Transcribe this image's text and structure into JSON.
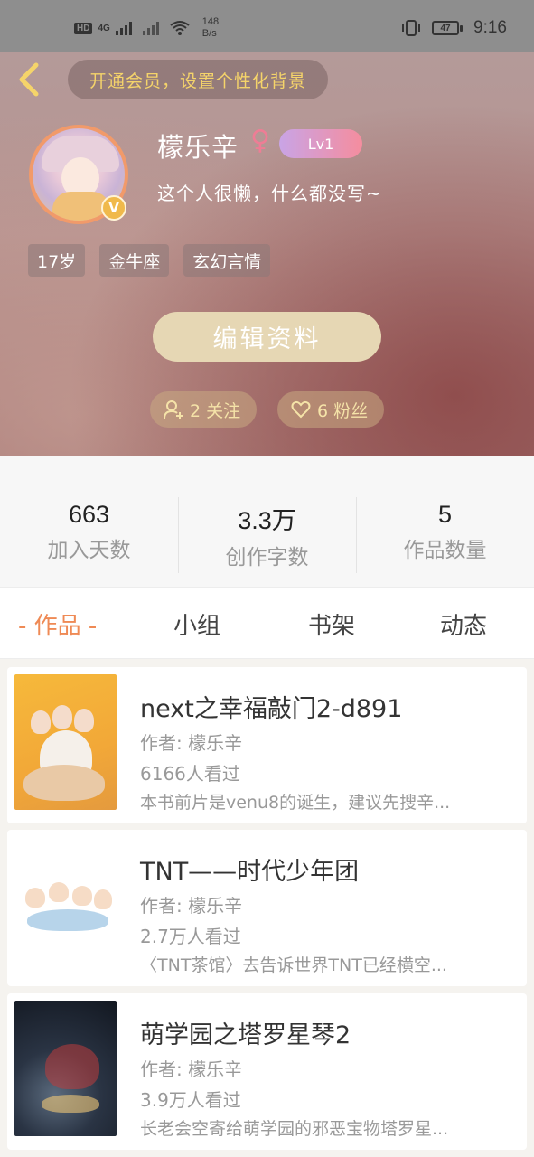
{
  "status_bar": {
    "network_badge": "HD",
    "net1": "4G",
    "speed_value": "148",
    "speed_unit": "B/s",
    "battery": "47",
    "time": "9:16"
  },
  "header": {
    "vip_prompt": "开通会员，设置个性化背景",
    "username": "檬乐辛",
    "gender_symbol": "♀",
    "level": "Lv1",
    "signature": "这个人很懒，什么都没写~",
    "vip_badge": "V",
    "tags": [
      "17岁",
      "金牛座",
      "玄幻言情"
    ],
    "edit_button": "编辑资料",
    "following": "2 关注",
    "followers": "6 粉丝"
  },
  "stats": [
    {
      "value": "663",
      "label": "加入天数"
    },
    {
      "value": "3.3万",
      "label": "创作字数"
    },
    {
      "value": "5",
      "label": "作品数量"
    }
  ],
  "tabs": [
    {
      "label": "- 作品 -",
      "active": true
    },
    {
      "label": "小组",
      "active": false
    },
    {
      "label": "书架",
      "active": false
    },
    {
      "label": "动态",
      "active": false
    }
  ],
  "works": [
    {
      "title": "next之幸福敲门2-d891",
      "author": "作者: 檬乐辛",
      "views": "6166人看过",
      "description": "本书前片是venu8的诞生，建议先搜辛..."
    },
    {
      "title": "TNT——时代少年团",
      "author": "作者: 檬乐辛",
      "views": "2.7万人看过",
      "description": "〈TNT茶馆〉去告诉世界TNT已经横空..."
    },
    {
      "title": "萌学园之塔罗星琴2",
      "author": "作者: 檬乐辛",
      "views": "3.9万人看过",
      "description": "长老会空寄给萌学园的邪恶宝物塔罗星..."
    }
  ],
  "colors": {
    "accent_orange": "#ef8a55",
    "vip_yellow": "#f5d46a",
    "gender_pink": "#ee7d95"
  }
}
